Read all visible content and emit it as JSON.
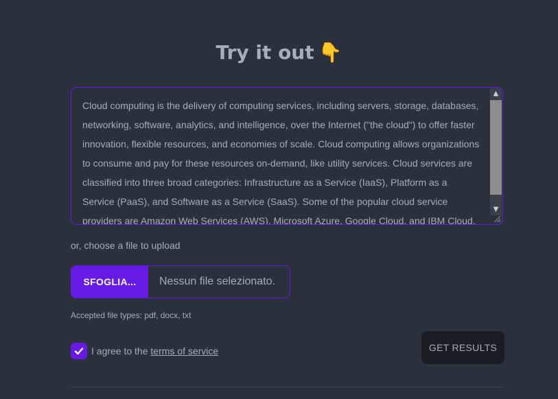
{
  "header": {
    "title": "Try it out",
    "title_emoji": "👇"
  },
  "input": {
    "text": "Cloud computing is the delivery of computing services, including servers, storage, databases, networking, software, analytics, and intelligence, over the Internet (\"the cloud\") to offer faster innovation, flexible resources, and economies of scale. Cloud computing allows organizations to consume and pay for these resources on-demand, like utility services. Cloud services are classified into three broad categories: Infrastructure as a Service (IaaS), Platform as a Service (PaaS), and Software as a Service (SaaS). Some of the popular cloud service providers are Amazon Web Services (AWS), Microsoft Azure, Google Cloud, and IBM Cloud."
  },
  "upload": {
    "or_label": "or, choose a file to upload",
    "browse_label": "SFOGLIA...",
    "status": "Nessun file selezionato.",
    "accepted_types": "Accepted file types: pdf, docx, txt"
  },
  "agreement": {
    "checked": true,
    "prefix": "I agree to the ",
    "link_text": "terms of service"
  },
  "actions": {
    "submit_label": "GET RESULTS"
  },
  "colors": {
    "background": "#2a303c",
    "primary": "#661ae6",
    "text": "#a6adbb",
    "button_dark": "#191d24"
  }
}
